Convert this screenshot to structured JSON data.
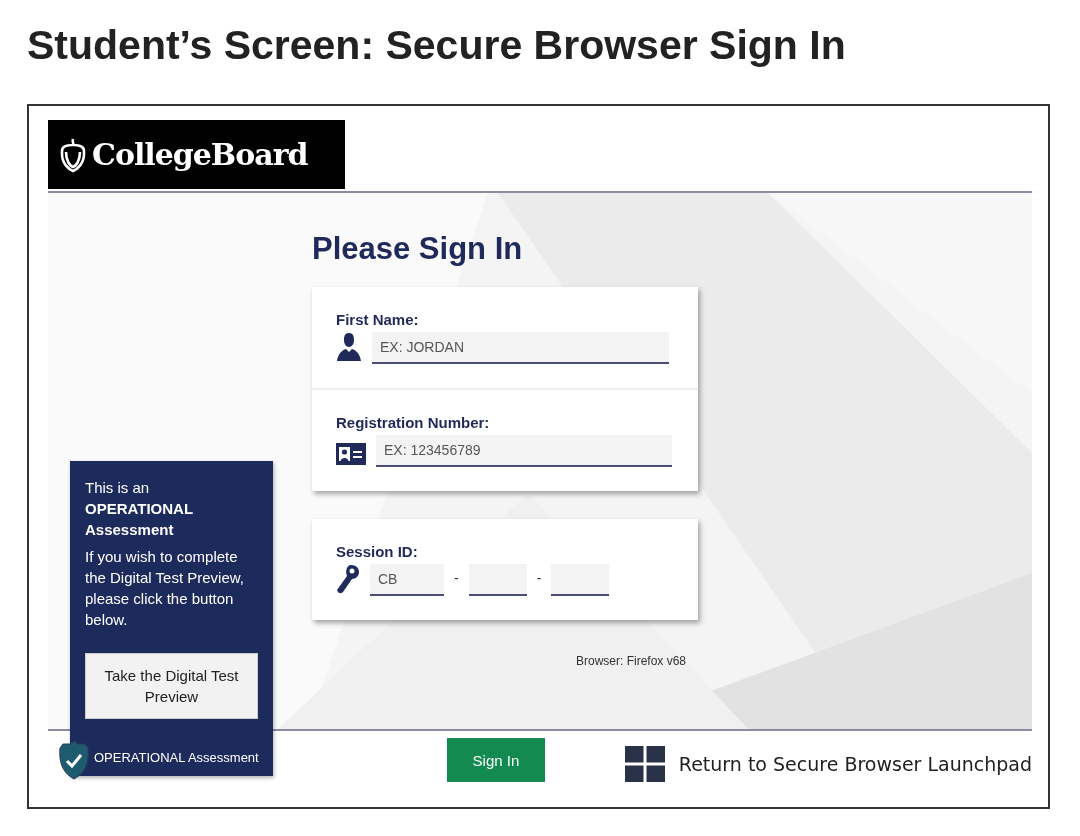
{
  "heading": "Student’s Screen: Secure Browser Sign In",
  "logo": {
    "text": "CollegeBoard"
  },
  "title": "Please Sign In",
  "fields": [
    {
      "kind": "person",
      "label": "First Name:",
      "placeholder": "EX: JORDAN"
    },
    {
      "kind": "card",
      "label": "Registration Number:",
      "placeholder": "EX: 123456789"
    }
  ],
  "session": {
    "label": "Session ID:",
    "prefix": "CB",
    "separators": [
      "-",
      "-"
    ]
  },
  "browser": "Browser: Firefox v68",
  "notice": {
    "intro": "This is an **OPERATIONAL Assessment**",
    "message": "If you wish to complete the Digital Test Preview, please click the button below.",
    "button": "Take the Digital Test Preview",
    "badge": "OPERATIONAL Assessment"
  },
  "footer": {
    "sign_in": "Sign In",
    "launchpad": "Return to Secure Browser Launchpad"
  }
}
